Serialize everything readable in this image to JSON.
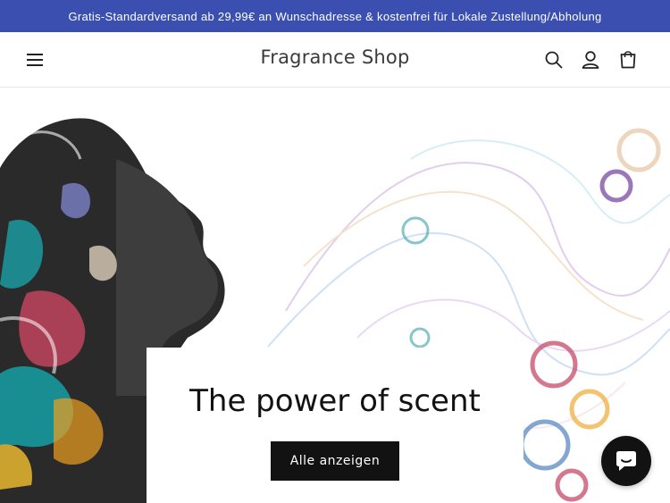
{
  "announcement": {
    "text": "Gratis-Standardversand ab 29,99€ an Wunschadresse & kostenfrei für Lokale Zustellung/Abholung"
  },
  "header": {
    "logo": "Fragrance Shop",
    "icons": [
      "menu-icon",
      "search-icon",
      "account-icon",
      "cart-icon"
    ]
  },
  "hero": {
    "title": "The power of scent",
    "button_label": "Alle anzeigen"
  },
  "chat": {
    "icon": "chat-icon"
  },
  "colors": {
    "announcement_bg": "#3a4fb0",
    "button_bg": "#121212",
    "text": "#121212"
  }
}
